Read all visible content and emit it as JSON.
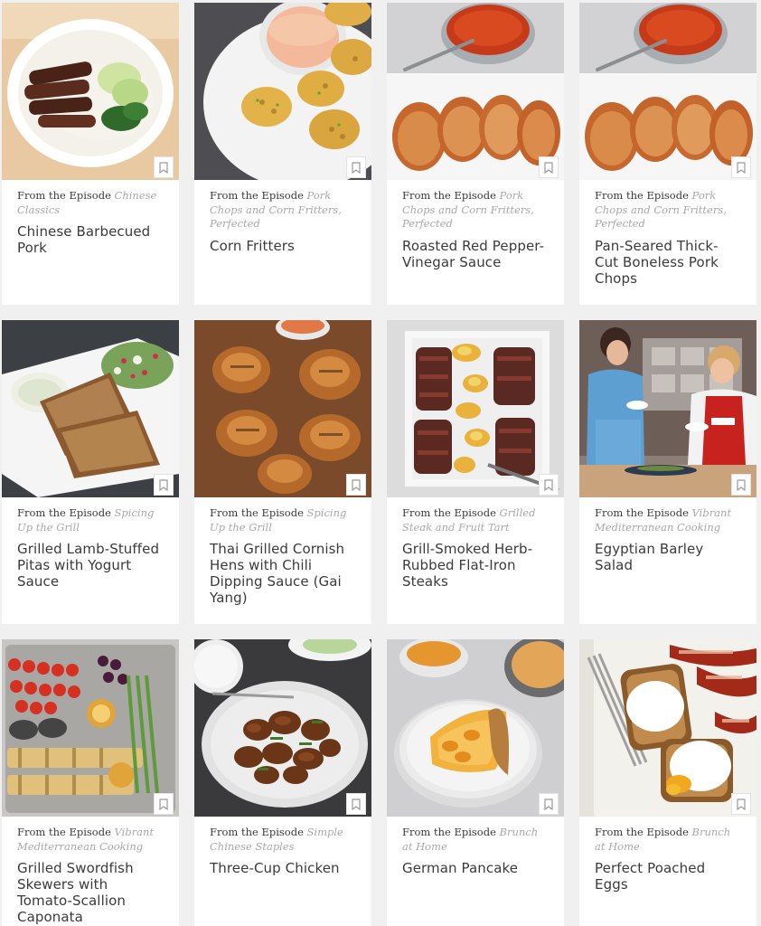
{
  "prefix": "From the Episode",
  "cards": [
    {
      "episode": "Chinese Classics",
      "title": "Chinese Barbecued Pork"
    },
    {
      "episode": "Pork Chops and Corn Fritters, Perfected",
      "title": "Corn Fritters"
    },
    {
      "episode": "Pork Chops and Corn Fritters, Perfected",
      "title": "Roasted Red Pepper-Vinegar Sauce"
    },
    {
      "episode": "Pork Chops and Corn Fritters, Perfected",
      "title": "Pan-Seared Thick-Cut Boneless Pork Chops"
    },
    {
      "episode": "Spicing Up the Grill",
      "title": "Grilled Lamb-Stuffed Pitas with Yogurt Sauce"
    },
    {
      "episode": "Spicing Up the Grill",
      "title": "Thai Grilled Cornish Hens with Chili Dipping Sauce (Gai Yang)"
    },
    {
      "episode": "Grilled Steak and Fruit Tart",
      "title": "Grill-Smoked Herb-Rubbed Flat-Iron Steaks"
    },
    {
      "episode": "Vibrant Mediterranean Cooking",
      "title": "Egyptian Barley Salad"
    },
    {
      "episode": "Vibrant Mediterranean Cooking",
      "title": "Grilled Swordfish Skewers with Tomato-Scallion Caponata"
    },
    {
      "episode": "Simple Chinese Staples",
      "title": "Three-Cup Chicken"
    },
    {
      "episode": "Brunch at Home",
      "title": "German Pancake"
    },
    {
      "episode": "Brunch at Home",
      "title": "Perfect Poached Eggs"
    }
  ]
}
